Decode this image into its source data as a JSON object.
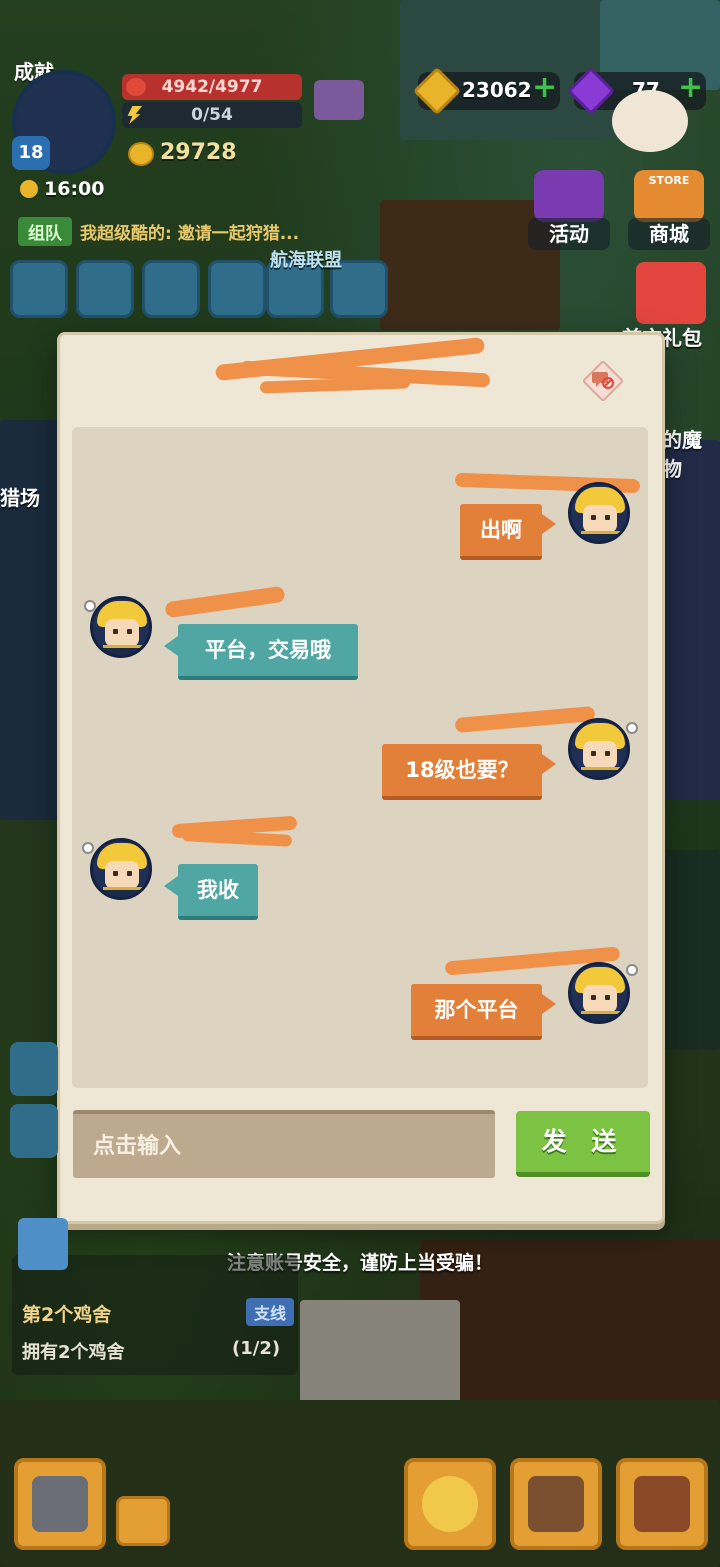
{
  "hud": {
    "header_label": "成就",
    "hp": "4942/4977",
    "energy": "0/54",
    "gold": "29728",
    "time": "16:00",
    "level": "18",
    "coins": "23062",
    "gems": "77",
    "activity_label": "活动",
    "store_label": "商城",
    "store_sign": "STORE",
    "team_tag": "组队",
    "team_message": "我超级酷的: 邀请一起狩猎...",
    "alliance_label": "航海联盟",
    "gift_label": "首充礼包",
    "hunting_label": "猎场",
    "monster_label": "的魔物"
  },
  "chat": {
    "messages": [
      {
        "side": "me",
        "text": "出啊"
      },
      {
        "side": "them",
        "text": "平台，交易哦"
      },
      {
        "side": "me",
        "text": "18级也要？"
      },
      {
        "side": "them",
        "text": "我收"
      },
      {
        "side": "me",
        "text": "那个平台"
      }
    ],
    "input_placeholder": "点击输入",
    "send_label": "发 送",
    "warning": "注意账号安全，谨防上当受骗！"
  },
  "quest": {
    "title": "第2个鸡舍",
    "tag": "支线",
    "description": "拥有2个鸡舍",
    "progress": "(1/2)"
  },
  "colors": {
    "my_bubble": "#e27f39",
    "their_bubble": "#4fa6a2",
    "send_button": "#7cc343",
    "dialog_bg": "#efe7d6",
    "redaction": "#f0914a"
  }
}
